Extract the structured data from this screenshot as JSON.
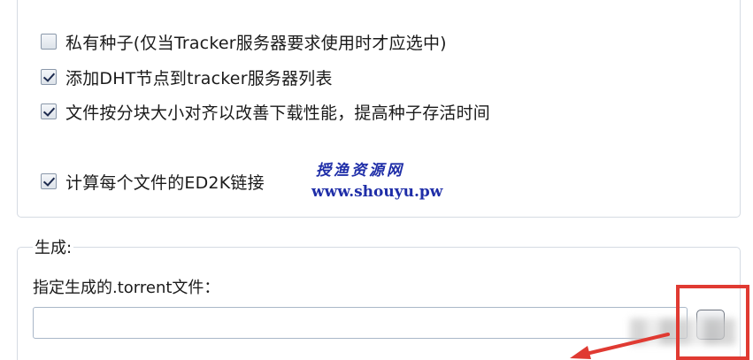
{
  "options": [
    {
      "label": "私有种子(仅当Tracker服务器要求使用时才应选中)",
      "checked": false
    },
    {
      "label": "添加DHT节点到tracker服务器列表",
      "checked": true
    },
    {
      "label": "文件按分块大小对齐以改善下载性能，提高种子存活时间",
      "checked": true
    },
    {
      "label": "计算每个文件的ED2K链接",
      "checked": true
    }
  ],
  "watermark": {
    "title": "授渔资源网",
    "url": "www.shouyu.pw"
  },
  "generate": {
    "legend": "生成:",
    "output_label": "指定生成的.torrent文件：",
    "output_value": ""
  },
  "colors": {
    "highlight": "#e03a32",
    "watermark": "#1f2ea8"
  }
}
